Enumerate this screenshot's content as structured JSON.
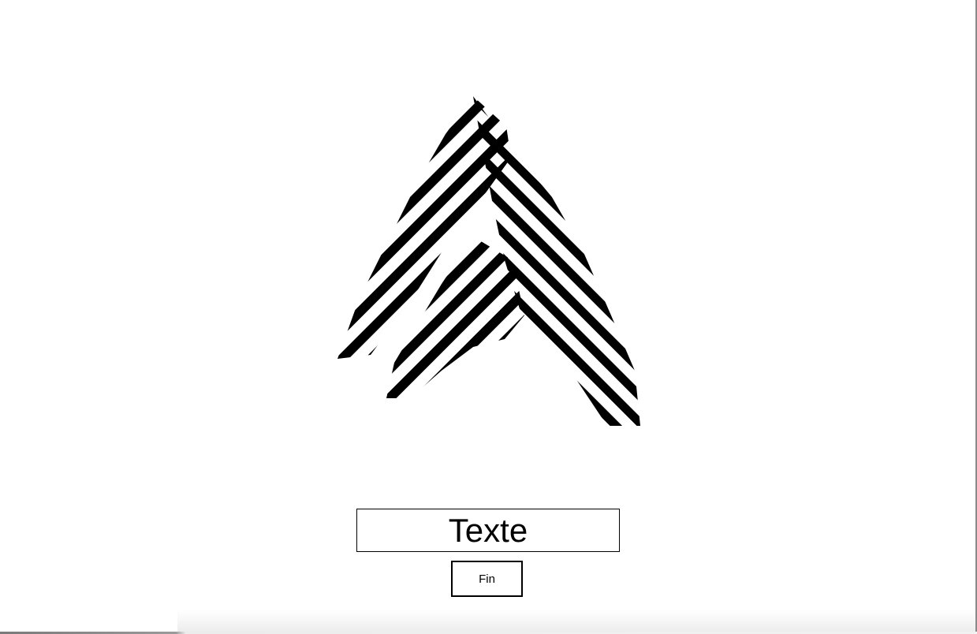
{
  "artwork": {
    "icon": "striped-chevron-up-logo",
    "stripe_color": "#000000",
    "background_color": "#ffffff"
  },
  "form": {
    "text_value": "Texte",
    "button_label": "Fin"
  }
}
